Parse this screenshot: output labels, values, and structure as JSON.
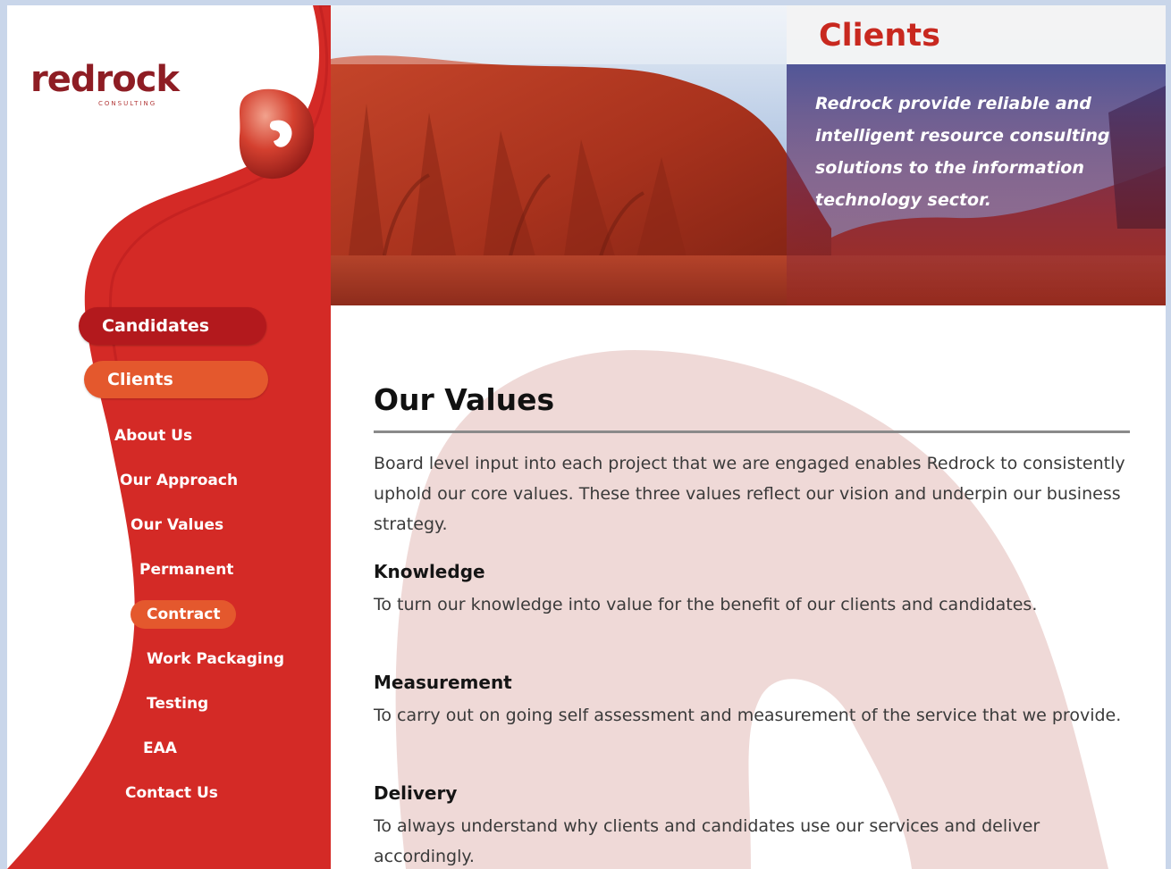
{
  "brand": {
    "name": "redrock",
    "tagline_small": "CONSULTING",
    "colors": {
      "primary_red": "#d42a26",
      "accent_orange": "#e4582d",
      "dark_red": "#8e1d24"
    }
  },
  "header": {
    "section_title": "Clients",
    "tagline": "Redrock provide reliable and intelligent resource consulting solutions to the information technology sector."
  },
  "nav": {
    "main": [
      {
        "label": "Candidates",
        "active": false
      },
      {
        "label": "Clients",
        "active": true
      }
    ],
    "sub": [
      {
        "label": "About Us",
        "active": false
      },
      {
        "label": "Our Approach",
        "active": false
      },
      {
        "label": "Our Values",
        "active": false
      },
      {
        "label": "Permanent",
        "active": false
      },
      {
        "label": "Contract",
        "active": true
      },
      {
        "label": "Work Packaging",
        "active": false
      },
      {
        "label": "Testing",
        "active": false
      },
      {
        "label": "EAA",
        "active": false
      },
      {
        "label": "Contact Us",
        "active": false
      }
    ]
  },
  "content": {
    "title": "Our Values",
    "intro": "Board level input into each project that we are engaged enables Redrock to consistently uphold our core values. These three values reflect our vision and underpin our business strategy.",
    "values": [
      {
        "heading": "Knowledge",
        "text": "To turn our knowledge into value for the benefit of our clients and candidates."
      },
      {
        "heading": "Measurement",
        "text": "To carry out on going self assessment and measurement of the service that we provide."
      },
      {
        "heading": "Delivery",
        "text": "To always understand why clients and candidates use our services and deliver accordingly."
      }
    ]
  }
}
